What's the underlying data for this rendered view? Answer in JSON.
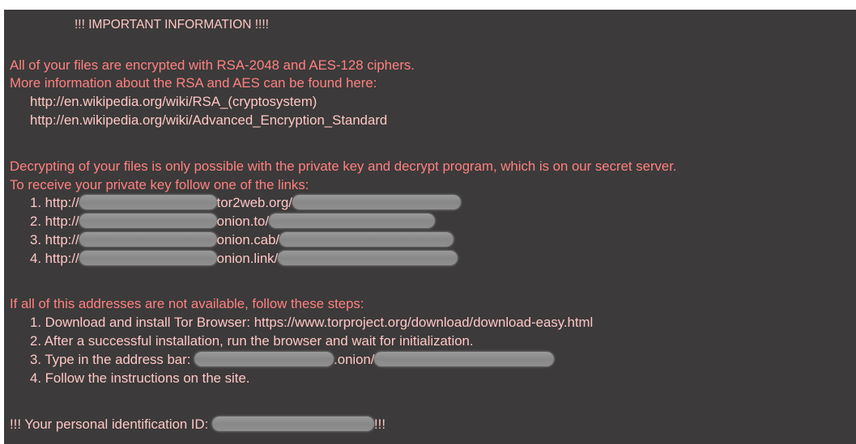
{
  "title": "!!! IMPORTANT INFORMATION !!!!",
  "intro": [
    "All of your files are encrypted with RSA-2048 and AES-128 ciphers.",
    "More information about the RSA and AES can be found here:"
  ],
  "info_links": [
    "http://en.wikipedia.org/wiki/RSA_(cryptosystem)",
    "http://en.wikipedia.org/wiki/Advanced_Encryption_Standard"
  ],
  "decrypt_text": [
    "Decrypting of your files is only possible with the private key and decrypt program, which is on our secret server.",
    "To receive your private key follow one of the links:"
  ],
  "onion_links": [
    {
      "num": "1.",
      "prefix": "http://",
      "domain": "tor2web.org/"
    },
    {
      "num": "2.",
      "prefix": "http://",
      "domain": "onion.to/"
    },
    {
      "num": "3.",
      "prefix": "http://",
      "domain": "onion.cab/"
    },
    {
      "num": "4.",
      "prefix": "http://",
      "domain": "onion.link/"
    }
  ],
  "fallback_intro": "If all of this addresses are not available, follow these steps:",
  "steps": {
    "s1": "1. Download and install Tor Browser: https://www.torproject.org/download/download-easy.html",
    "s2": "2. After a successful installation, run the browser and wait for initialization.",
    "s3_prefix": "3. Type in the address bar:",
    "s3_onion": ".onion/",
    "s4": "4. Follow the instructions on the site."
  },
  "personal_id_prefix": "!!! Your personal identification ID:",
  "personal_id_suffix": "!!!",
  "colors": {
    "background": "#3c3a3a",
    "warning_text": "#ff8080",
    "link_text": "#ffc6c6",
    "redaction": "#8f8f8f"
  }
}
